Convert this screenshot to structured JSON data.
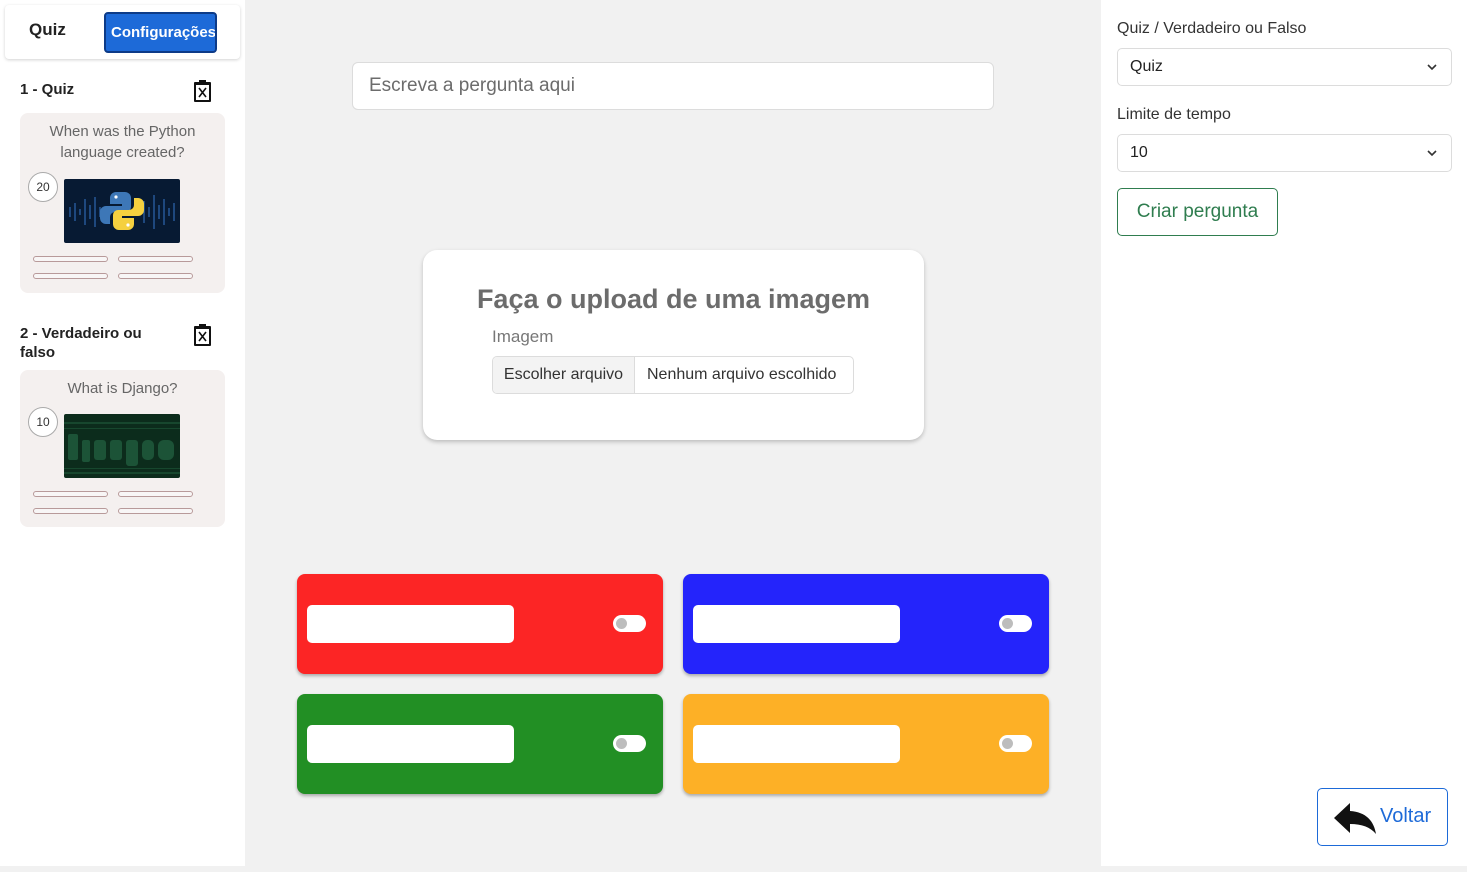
{
  "sidebar": {
    "tab_quiz": "Quiz",
    "tab_config": "Configurações",
    "questions": [
      {
        "header": "1 - Quiz",
        "text": "When was the Python language created?",
        "time": "20",
        "image": "python-logo-thumbnail"
      },
      {
        "header": "2 - Verdadeiro ou falso",
        "text": "What is Django?",
        "time": "10",
        "image": "django-logo-thumbnail"
      }
    ]
  },
  "main": {
    "question_placeholder": "Escreva a pergunta aqui",
    "upload": {
      "title": "Faça o upload de uma imagem",
      "label": "Imagem",
      "choose_button": "Escolher arquivo",
      "no_file": "Nenhum arquivo escolhido"
    },
    "answers": [
      {
        "color": "#fc2525"
      },
      {
        "color": "#2424fb"
      },
      {
        "color": "#228f24"
      },
      {
        "color": "#fdb026"
      }
    ]
  },
  "settings": {
    "type_label": "Quiz / Verdadeiro ou Falso",
    "type_value": "Quiz",
    "time_label": "Limite de tempo",
    "time_value": "10",
    "create_button": "Criar pergunta",
    "back_button": "Voltar"
  },
  "colors": {
    "primary": "#1d6ad8",
    "success": "#2f7d4f"
  }
}
